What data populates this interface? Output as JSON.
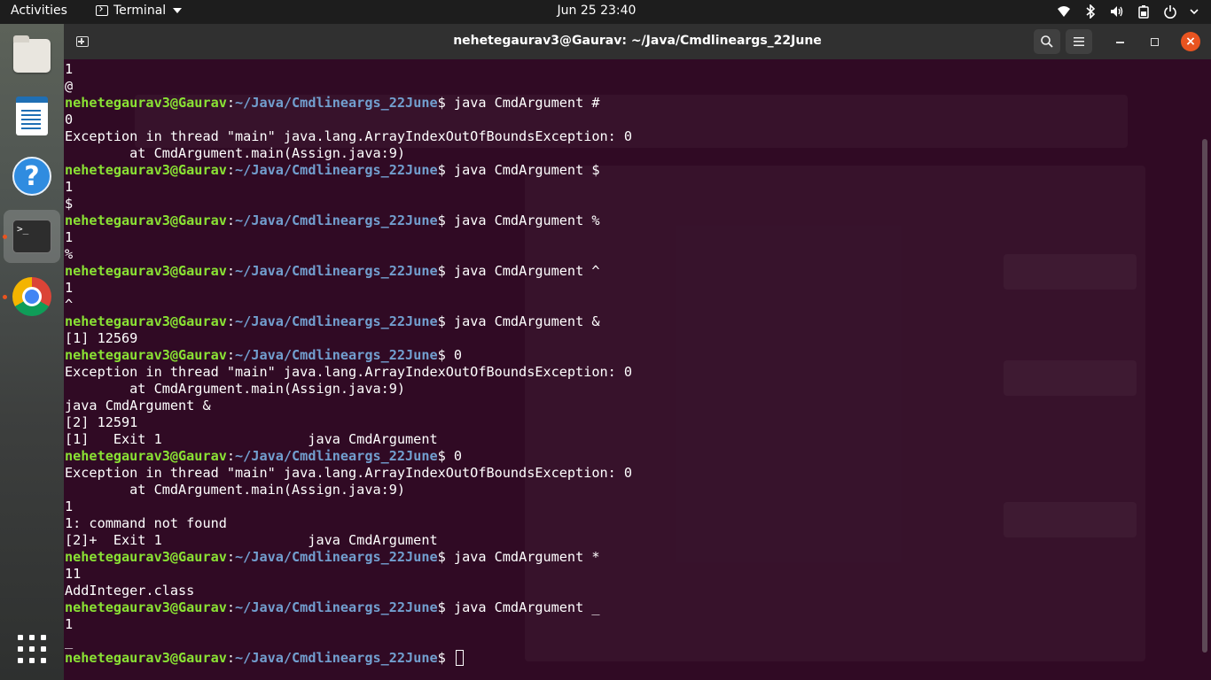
{
  "topbar": {
    "activities": "Activities",
    "app_name": "Terminal",
    "clock": "Jun 25  23:40",
    "tray_icons": [
      "wifi-icon",
      "bluetooth-icon",
      "volume-icon",
      "battery-icon",
      "power-icon"
    ]
  },
  "dock": {
    "items": [
      {
        "name": "files-icon",
        "running": false
      },
      {
        "name": "libreoffice-writer-icon",
        "running": false
      },
      {
        "name": "help-icon",
        "running": false
      },
      {
        "name": "terminal-icon",
        "running": true,
        "active": true
      },
      {
        "name": "chrome-icon",
        "running": true
      },
      {
        "name": "show-applications-icon",
        "running": false
      }
    ]
  },
  "window": {
    "title": "nehetegaurav3@Gaurav: ~/Java/Cmdlineargs_22June",
    "buttons": [
      "new-tab-icon",
      "search-icon",
      "hamburger-menu-icon",
      "minimize-icon",
      "maximize-icon",
      "close-icon"
    ]
  },
  "terminal": {
    "user_host": "nehetegaurav3@Gaurav",
    "path": "~/Java/Cmdlineargs_22June",
    "lines": [
      {
        "t": "out",
        "text": "1"
      },
      {
        "t": "out",
        "text": "@"
      },
      {
        "t": "prompt",
        "cmd": " java CmdArgument #"
      },
      {
        "t": "out",
        "text": "0"
      },
      {
        "t": "out",
        "text": "Exception in thread \"main\" java.lang.ArrayIndexOutOfBoundsException: 0"
      },
      {
        "t": "out",
        "text": "        at CmdArgument.main(Assign.java:9)"
      },
      {
        "t": "prompt",
        "cmd": " java CmdArgument $"
      },
      {
        "t": "out",
        "text": "1"
      },
      {
        "t": "out",
        "text": "$"
      },
      {
        "t": "prompt",
        "cmd": " java CmdArgument %"
      },
      {
        "t": "out",
        "text": "1"
      },
      {
        "t": "out",
        "text": "%"
      },
      {
        "t": "prompt",
        "cmd": " java CmdArgument ^"
      },
      {
        "t": "out",
        "text": "1"
      },
      {
        "t": "out",
        "text": "^"
      },
      {
        "t": "prompt",
        "cmd": " java CmdArgument &"
      },
      {
        "t": "out",
        "text": "[1] 12569"
      },
      {
        "t": "prompt",
        "cmd": " 0"
      },
      {
        "t": "out",
        "text": "Exception in thread \"main\" java.lang.ArrayIndexOutOfBoundsException: 0"
      },
      {
        "t": "out",
        "text": "        at CmdArgument.main(Assign.java:9)"
      },
      {
        "t": "out",
        "text": "java CmdArgument &"
      },
      {
        "t": "out",
        "text": "[2] 12591"
      },
      {
        "t": "out",
        "text": "[1]   Exit 1                  java CmdArgument"
      },
      {
        "t": "prompt",
        "cmd": " 0"
      },
      {
        "t": "out",
        "text": "Exception in thread \"main\" java.lang.ArrayIndexOutOfBoundsException: 0"
      },
      {
        "t": "out",
        "text": "        at CmdArgument.main(Assign.java:9)"
      },
      {
        "t": "out",
        "text": "1"
      },
      {
        "t": "out",
        "text": "1: command not found"
      },
      {
        "t": "out",
        "text": "[2]+  Exit 1                  java CmdArgument"
      },
      {
        "t": "prompt",
        "cmd": " java CmdArgument *"
      },
      {
        "t": "out",
        "text": "11"
      },
      {
        "t": "out",
        "text": "AddInteger.class"
      },
      {
        "t": "prompt",
        "cmd": " java CmdArgument _"
      },
      {
        "t": "out",
        "text": "1"
      },
      {
        "t": "out",
        "text": "_"
      },
      {
        "t": "prompt",
        "cmd": " ",
        "cursor": true
      }
    ]
  }
}
